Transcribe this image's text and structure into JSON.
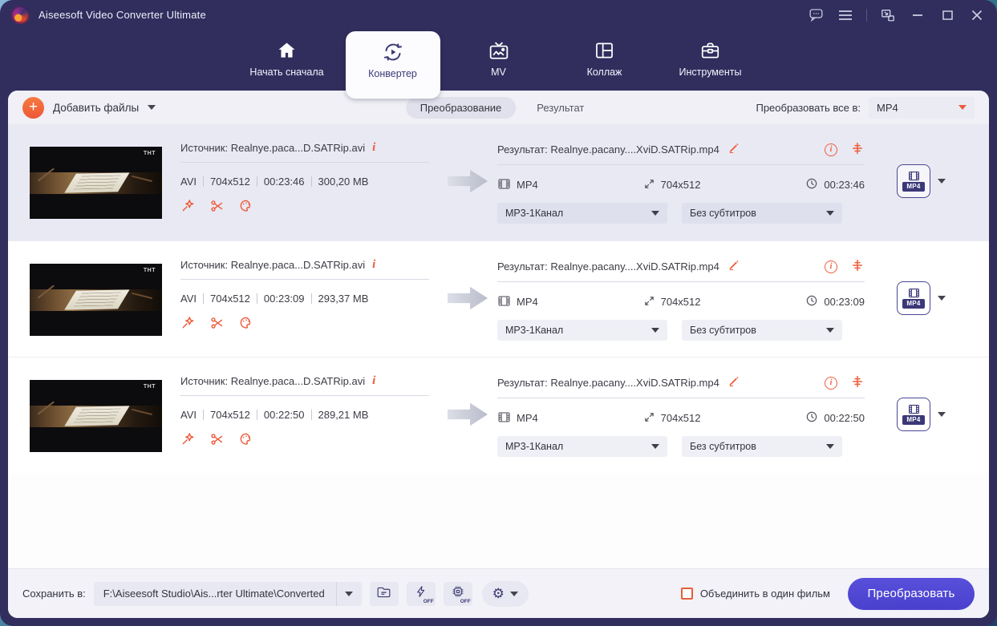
{
  "colors": {
    "accent_orange": "#ee5b3b",
    "primary_purple": "#4a41ce",
    "navbar_bg": "#312e5e",
    "selected_row_bg": "#e9e9f3",
    "toolbar_bg": "#f0f0f6",
    "footer_bg": "#f2f2f8"
  },
  "titlebar": {
    "title": "Aiseesoft Video Converter Ultimate"
  },
  "nav": {
    "tabs": [
      {
        "label": "Начать сначала"
      },
      {
        "label": "Конвертер"
      },
      {
        "label": "MV"
      },
      {
        "label": "Коллаж"
      },
      {
        "label": "Инструменты"
      }
    ]
  },
  "toolbar": {
    "add_files": "Добавить файлы",
    "tab_convert": "Преобразование",
    "tab_result": "Результат",
    "convert_all_label": "Преобразовать все в:",
    "convert_all_value": "MP4"
  },
  "rows": [
    {
      "source": "Источник: Realnye.paca...D.SATRip.avi",
      "format": "AVI",
      "resolution": "704x512",
      "duration": "00:23:46",
      "size": "300,20 MB",
      "result": "Результат: Realnye.pacany....XviD.SATRip.mp4",
      "out_format": "MP4",
      "out_resolution": "704x512",
      "out_duration": "00:23:46",
      "audio_track": "MP3-1Канал",
      "subtitle": "Без субтитров",
      "profile": "MP4"
    },
    {
      "source": "Источник: Realnye.paca...D.SATRip.avi",
      "format": "AVI",
      "resolution": "704x512",
      "duration": "00:23:09",
      "size": "293,37 MB",
      "result": "Результат: Realnye.pacany....XviD.SATRip.mp4",
      "out_format": "MP4",
      "out_resolution": "704x512",
      "out_duration": "00:23:09",
      "audio_track": "MP3-1Канал",
      "subtitle": "Без субтитров",
      "profile": "MP4"
    },
    {
      "source": "Источник: Realnye.paca...D.SATRip.avi",
      "format": "AVI",
      "resolution": "704x512",
      "duration": "00:22:50",
      "size": "289,21 MB",
      "result": "Результат: Realnye.pacany....XviD.SATRip.mp4",
      "out_format": "MP4",
      "out_resolution": "704x512",
      "out_duration": "00:22:50",
      "audio_track": "MP3-1Канал",
      "subtitle": "Без субтитров",
      "profile": "MP4"
    }
  ],
  "thumbnail": {
    "watermark": "ТНТ"
  },
  "footer": {
    "save_label": "Сохранить в:",
    "save_path": "F:\\Aiseesoft Studio\\Ais...rter Ultimate\\Converted",
    "off": "OFF",
    "gear_glyph": "⚙",
    "merge_label": "Объединить в один фильм",
    "convert_button": "Преобразовать"
  },
  "icons": {
    "app_logo": "circular-gradient-swirl",
    "titlebar": [
      "feedback-bubble-icon",
      "menu-icon",
      "mini-mode-icon",
      "minimize-icon",
      "maximize-icon",
      "close-icon"
    ],
    "nav": [
      "home-icon",
      "convert-icon",
      "tv-icon",
      "collage-icon",
      "toolbox-icon"
    ],
    "row": [
      "info-icon",
      "edit-effects-icon",
      "cut-icon",
      "palette-icon",
      "rename-pencil-icon",
      "info-circle-icon",
      "equalizer-icon",
      "film-icon",
      "resolution-expand-icon",
      "clock-icon"
    ],
    "footer": [
      "open-folder-icon",
      "lightning-icon",
      "gpu-chip-icon",
      "gear-icon"
    ]
  }
}
